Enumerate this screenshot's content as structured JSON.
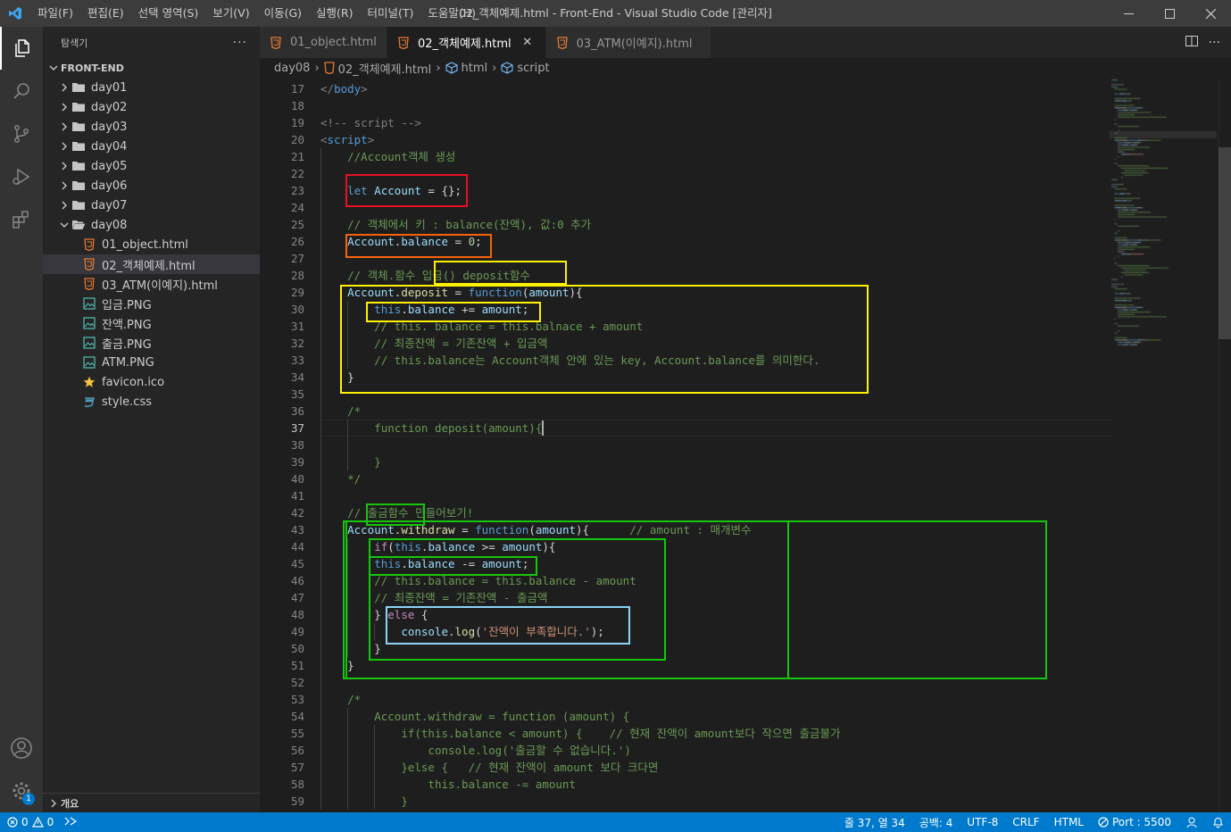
{
  "window": {
    "title": "02_객체예제.html - Front-End - Visual Studio Code [관리자]",
    "menu": [
      "파일(F)",
      "편집(E)",
      "선택 영역(S)",
      "보기(V)",
      "이동(G)",
      "실행(R)",
      "터미널(T)",
      "도움말(H)"
    ],
    "controls": [
      "minimize-icon",
      "maximize-icon",
      "close-icon"
    ]
  },
  "activity_bar": {
    "items": [
      "explorer-icon",
      "search-icon",
      "source-control-icon",
      "run-debug-icon",
      "extensions-icon"
    ],
    "bottom": [
      "accounts-icon",
      "settings-gear-icon"
    ],
    "settings_badge": "1"
  },
  "sidebar": {
    "title": "탐색기",
    "more": "···",
    "section": "FRONT-END",
    "folders": [
      "day01",
      "day02",
      "day03",
      "day04",
      "day05",
      "day06",
      "day07"
    ],
    "open_folder": "day08",
    "files": [
      {
        "name": "01_object.html",
        "icon": "html-icon"
      },
      {
        "name": "02_객체예제.html",
        "icon": "html-icon",
        "selected": true
      },
      {
        "name": "03_ATM(이예지).html",
        "icon": "html-icon"
      },
      {
        "name": "입금.PNG",
        "icon": "image-icon"
      },
      {
        "name": "잔액.PNG",
        "icon": "image-icon"
      },
      {
        "name": "출금.PNG",
        "icon": "image-icon"
      },
      {
        "name": "ATM.PNG",
        "icon": "image-icon"
      },
      {
        "name": "favicon.ico",
        "icon": "star-icon"
      },
      {
        "name": "style.css",
        "icon": "css-icon"
      }
    ],
    "footer": "개요"
  },
  "tabs": [
    {
      "label": "01_object.html",
      "active": false
    },
    {
      "label": "02_객체예제.html",
      "active": true,
      "close": "✕"
    },
    {
      "label": "03_ATM(이예지).html",
      "active": false
    }
  ],
  "breadcrumb": [
    "day08",
    "02_객체예제.html",
    "html",
    "script"
  ],
  "editor": {
    "first_line": 17,
    "current_line": 37,
    "lines": [
      [
        [
          "tg",
          "</"
        ],
        [
          "tn",
          "body"
        ],
        [
          "tg",
          ">"
        ]
      ],
      [],
      [
        [
          "tg",
          "<!-- script -->"
        ]
      ],
      [
        [
          "tg",
          "<"
        ],
        [
          "tn",
          "script"
        ],
        [
          "tg",
          ">"
        ]
      ],
      [
        [
          "tx",
          "    "
        ],
        [
          "cm",
          "//Account객체 생성"
        ]
      ],
      [],
      [
        [
          "tx",
          "    "
        ],
        [
          "kw",
          "let"
        ],
        [
          "tx",
          " "
        ],
        [
          "vr",
          "Account"
        ],
        [
          "tx",
          " = {};"
        ]
      ],
      [],
      [
        [
          "tx",
          "    "
        ],
        [
          "cm",
          "// 객체에서 키 : balance(잔액), 값:0 추가"
        ]
      ],
      [
        [
          "tx",
          "    "
        ],
        [
          "vr",
          "Account"
        ],
        [
          "tx",
          "."
        ],
        [
          "vr",
          "balance"
        ],
        [
          "tx",
          " = "
        ],
        [
          "nm",
          "0"
        ],
        [
          "tx",
          ";"
        ]
      ],
      [],
      [
        [
          "tx",
          "    "
        ],
        [
          "cm",
          "// 객체.함수 입금() deposit함수"
        ]
      ],
      [
        [
          "tx",
          "    "
        ],
        [
          "vr",
          "Account"
        ],
        [
          "tx",
          "."
        ],
        [
          "fn",
          "deposit"
        ],
        [
          "tx",
          " = "
        ],
        [
          "kw",
          "function"
        ],
        [
          "tx",
          "("
        ],
        [
          "vr",
          "amount"
        ],
        [
          "tx",
          "){"
        ]
      ],
      [
        [
          "tx",
          "        "
        ],
        [
          "kw",
          "this"
        ],
        [
          "tx",
          "."
        ],
        [
          "vr",
          "balance"
        ],
        [
          "tx",
          " += "
        ],
        [
          "vr",
          "amount"
        ],
        [
          "tx",
          ";"
        ]
      ],
      [
        [
          "tx",
          "        "
        ],
        [
          "cm",
          "// this. balance = this.balnace + amount"
        ]
      ],
      [
        [
          "tx",
          "        "
        ],
        [
          "cm",
          "// 최종잔액 = 기존잔액 + 입금액"
        ]
      ],
      [
        [
          "tx",
          "        "
        ],
        [
          "cm",
          "// this.balance는 Account객체 안에 있는 key, Account.balance를 의미한다."
        ]
      ],
      [
        [
          "tx",
          "    }"
        ]
      ],
      [],
      [
        [
          "tx",
          "    "
        ],
        [
          "cm",
          "/*"
        ]
      ],
      [
        [
          "tx",
          "        "
        ],
        [
          "cm",
          "function deposit(amount){"
        ]
      ],
      [],
      [
        [
          "tx",
          "        "
        ],
        [
          "cm",
          "}"
        ]
      ],
      [
        [
          "tx",
          "    "
        ],
        [
          "cm",
          "*/"
        ]
      ],
      [],
      [
        [
          "tx",
          "    "
        ],
        [
          "cm",
          "// 출금함수 만들어보기!"
        ]
      ],
      [
        [
          "tx",
          "    "
        ],
        [
          "vr",
          "Account"
        ],
        [
          "tx",
          "."
        ],
        [
          "fn",
          "withdraw"
        ],
        [
          "tx",
          " = "
        ],
        [
          "kw",
          "function"
        ],
        [
          "tx",
          "("
        ],
        [
          "vr",
          "amount"
        ],
        [
          "tx",
          "){      "
        ],
        [
          "cm",
          "// amount : 매개변수"
        ]
      ],
      [
        [
          "tx",
          "        "
        ],
        [
          "cf",
          "if"
        ],
        [
          "tx",
          "("
        ],
        [
          "kw",
          "this"
        ],
        [
          "tx",
          "."
        ],
        [
          "vr",
          "balance"
        ],
        [
          "tx",
          " >= "
        ],
        [
          "vr",
          "amount"
        ],
        [
          "tx",
          "){"
        ]
      ],
      [
        [
          "tx",
          "        "
        ],
        [
          "kw",
          "this"
        ],
        [
          "tx",
          "."
        ],
        [
          "vr",
          "balance"
        ],
        [
          "tx",
          " -= "
        ],
        [
          "vr",
          "amount"
        ],
        [
          "tx",
          ";"
        ]
      ],
      [
        [
          "tx",
          "        "
        ],
        [
          "cm",
          "// this.balance = this.balance - amount"
        ]
      ],
      [
        [
          "tx",
          "        "
        ],
        [
          "cm",
          "// 최종잔액 = 기존잔액 - 출금액"
        ]
      ],
      [
        [
          "tx",
          "        } "
        ],
        [
          "cf",
          "else"
        ],
        [
          "tx",
          " {"
        ]
      ],
      [
        [
          "tx",
          "            "
        ],
        [
          "vr",
          "console"
        ],
        [
          "tx",
          "."
        ],
        [
          "fn",
          "log"
        ],
        [
          "tx",
          "("
        ],
        [
          "st",
          "'잔액이 부족합니다.'"
        ],
        [
          "tx",
          ");"
        ]
      ],
      [
        [
          "tx",
          "        }"
        ]
      ],
      [
        [
          "tx",
          "    }"
        ]
      ],
      [],
      [
        [
          "tx",
          "    "
        ],
        [
          "cm",
          "/*"
        ]
      ],
      [
        [
          "tx",
          "        "
        ],
        [
          "cm",
          "Account.withdraw = function (amount) {"
        ]
      ],
      [
        [
          "tx",
          "            "
        ],
        [
          "cm",
          "if(this.balance < amount) {    // 현재 잔액이 amount보다 작으면 출금불가"
        ]
      ],
      [
        [
          "tx",
          "                "
        ],
        [
          "cm",
          "console.log('출금할 수 없습니다.')"
        ]
      ],
      [
        [
          "tx",
          "            "
        ],
        [
          "cm",
          "}else {   // 현재 잔액이 amount 보다 크다면"
        ]
      ],
      [
        [
          "tx",
          "                "
        ],
        [
          "cm",
          "this.balance -= amount"
        ]
      ],
      [
        [
          "tx",
          "            "
        ],
        [
          "cm",
          "}"
        ]
      ]
    ]
  },
  "annotation_colors": [
    "#e81123",
    "#f7630c",
    "#fff100",
    "#16c60c",
    "#8bd4f5"
  ],
  "statusbar": {
    "errors": "0",
    "warnings": "0",
    "position": "줄 37, 열 34",
    "spaces": "공백: 4",
    "encoding": "UTF-8",
    "eol": "CRLF",
    "language": "HTML",
    "port": "Port : 5500"
  }
}
